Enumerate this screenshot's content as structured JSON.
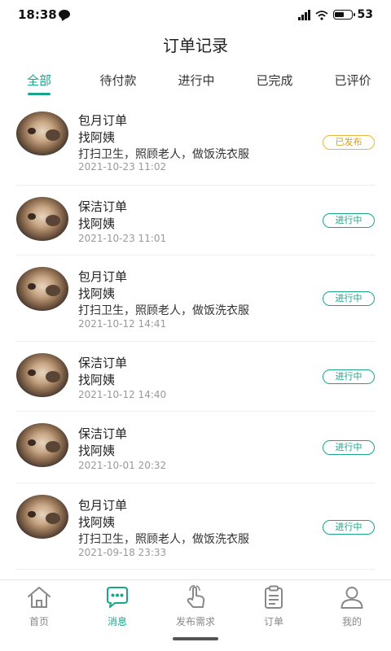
{
  "status_bar": {
    "time": "18:38",
    "battery": "53"
  },
  "header": {
    "title": "订单记录"
  },
  "tabs": [
    {
      "label": "全部",
      "active": true
    },
    {
      "label": "待付款",
      "active": false
    },
    {
      "label": "进行中",
      "active": false
    },
    {
      "label": "已完成",
      "active": false
    },
    {
      "label": "已评价",
      "active": false
    }
  ],
  "orders": [
    {
      "title": "包月订单",
      "subtitle": "找阿姨",
      "desc": "打扫卫生，照顾老人，做饭洗衣服",
      "time": "2021-10-23 11:02",
      "status": "已发布",
      "status_type": "published"
    },
    {
      "title": "保洁订单",
      "subtitle": "找阿姨",
      "desc": "",
      "time": "2021-10-23 11:01",
      "status": "进行中",
      "status_type": "inprogress"
    },
    {
      "title": "包月订单",
      "subtitle": "找阿姨",
      "desc": "打扫卫生，照顾老人，做饭洗衣服",
      "time": "2021-10-12 14:41",
      "status": "进行中",
      "status_type": "inprogress"
    },
    {
      "title": "保洁订单",
      "subtitle": "找阿姨",
      "desc": "",
      "time": "2021-10-12 14:40",
      "status": "进行中",
      "status_type": "inprogress"
    },
    {
      "title": "保洁订单",
      "subtitle": "找阿姨",
      "desc": "",
      "time": "2021-10-01 20:32",
      "status": "进行中",
      "status_type": "inprogress"
    },
    {
      "title": "包月订单",
      "subtitle": "找阿姨",
      "desc": "打扫卫生，照顾老人，做饭洗衣服",
      "time": "2021-09-18 23:33",
      "status": "进行中",
      "status_type": "inprogress"
    }
  ],
  "bottom_nav": [
    {
      "label": "首页",
      "icon": "home-icon",
      "active": false
    },
    {
      "label": "消息",
      "icon": "message-icon",
      "active": true
    },
    {
      "label": "发布需求",
      "icon": "hand-tap-icon",
      "active": false
    },
    {
      "label": "订单",
      "icon": "clipboard-icon",
      "active": false
    },
    {
      "label": "我的",
      "icon": "user-icon",
      "active": false
    }
  ],
  "colors": {
    "accent": "#1aa58a",
    "published": "#d99e16"
  }
}
